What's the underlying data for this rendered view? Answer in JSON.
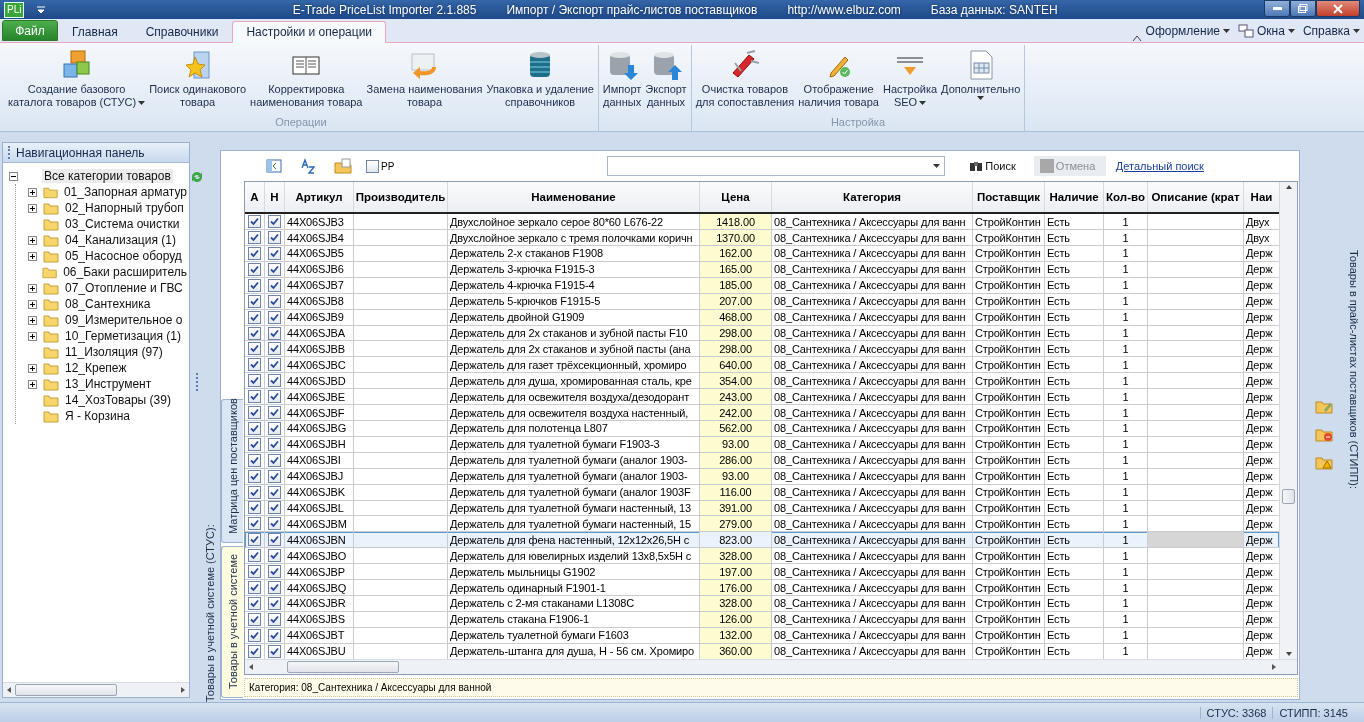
{
  "window": {
    "app_badge": "PLi",
    "title_parts": [
      "E-Trade PriceList Importer 2.1.885",
      "Импорт / Экспорт прайс-листов поставщиков",
      "http://www.elbuz.com",
      "База данных: SANTEH"
    ]
  },
  "ribbon": {
    "file_tab": "Файл",
    "tabs": [
      {
        "label": "Главная",
        "selected": false
      },
      {
        "label": "Справочники",
        "selected": false
      },
      {
        "label": "Настройки и операции",
        "selected": true
      }
    ],
    "right_menus": [
      "Оформление",
      "Окна",
      "Справка"
    ],
    "groups": [
      {
        "label": "Операции",
        "items": [
          {
            "lines": [
              "Создание базового",
              "каталога товаров (СТУС)"
            ],
            "dropdown": true
          },
          {
            "lines": [
              "Поиск одинакового",
              "товара"
            ],
            "dropdown": false
          },
          {
            "lines": [
              "Корректировка",
              "наименования товара"
            ],
            "dropdown": false
          },
          {
            "lines": [
              "Замена наименования",
              "товара"
            ],
            "dropdown": false
          },
          {
            "lines": [
              "Упаковка и удаление",
              "справочников"
            ],
            "dropdown": false
          }
        ]
      },
      {
        "items": [
          {
            "lines": [
              "Импорт",
              "данных"
            ],
            "dropdown": false
          },
          {
            "lines": [
              "Экспорт",
              "данных"
            ],
            "dropdown": false
          }
        ]
      },
      {
        "label": "Настройка",
        "items": [
          {
            "lines": [
              "Очистка товаров",
              "для сопоставления"
            ],
            "dropdown": false
          },
          {
            "lines": [
              "Отображение",
              "наличия товара"
            ],
            "dropdown": false
          },
          {
            "lines": [
              "Настройка",
              "SEO"
            ],
            "dropdown": true
          },
          {
            "lines": [
              "Дополнительно"
            ],
            "dropdown": true
          }
        ]
      }
    ]
  },
  "navigation": {
    "title": "Навигационная панель",
    "root": {
      "label": "Все категории товаров",
      "expanded": true,
      "selected": true,
      "children": [
        {
          "label": "01_Запорная арматур",
          "expandable": true,
          "selected": false
        },
        {
          "label": "02_Напорный трубоп",
          "expandable": true,
          "selected": false
        },
        {
          "label": "03_Система очистки",
          "expandable": false,
          "selected": false
        },
        {
          "label": "04_Канализация (1)",
          "expandable": true,
          "selected": false
        },
        {
          "label": "05_Насосное оборуд",
          "expandable": true,
          "selected": false
        },
        {
          "label": "06_Баки расширитель",
          "expandable": false,
          "selected": false
        },
        {
          "label": "07_Отопление и ГВС",
          "expandable": true,
          "selected": false
        },
        {
          "label": "08_Сантехника",
          "expandable": true,
          "selected": false
        },
        {
          "label": "09_Измерительное о",
          "expandable": true,
          "selected": false
        },
        {
          "label": "10_Герметизация (1)",
          "expandable": true,
          "selected": false
        },
        {
          "label": "11_Изоляция (97)",
          "expandable": false,
          "selected": false
        },
        {
          "label": "12_Крепеж",
          "expandable": true,
          "selected": false
        },
        {
          "label": "13_Инструмент",
          "expandable": true,
          "selected": false
        },
        {
          "label": "14_ХозТовары (39)",
          "expandable": false,
          "selected": false
        },
        {
          "label": "Я - Корзина",
          "expandable": false,
          "selected": false
        }
      ]
    }
  },
  "stus_caption": "Товары в учетной системе (СТУС):",
  "view_tabs": [
    {
      "label": "Матрица цен поставщиков",
      "selected": false
    },
    {
      "label": "Товары в учетной системе",
      "selected": true
    }
  ],
  "toolbar": {
    "pp": {
      "label": "PP",
      "checked": false
    },
    "search_button": "Поиск",
    "cancel": {
      "label": "Отмена",
      "disabled": true
    },
    "detail_link": "Детальный поиск"
  },
  "table": {
    "columns": [
      {
        "label": "А",
        "kind": "check"
      },
      {
        "label": "Н",
        "kind": "check"
      },
      {
        "label": "Артикул",
        "kind": "text"
      },
      {
        "label": "Производитель",
        "kind": "text"
      },
      {
        "label": "Наименование",
        "kind": "text"
      },
      {
        "label": "Цена",
        "kind": "price"
      },
      {
        "label": "Категория",
        "kind": "text"
      },
      {
        "label": "Поставщик",
        "kind": "text"
      },
      {
        "label": "Наличие",
        "kind": "text"
      },
      {
        "label": "Кол-во",
        "kind": "number"
      },
      {
        "label": "Описание (крат",
        "kind": "text"
      },
      {
        "label": "Наи",
        "kind": "text"
      }
    ],
    "rows": [
      {
        "a": true,
        "h": true,
        "article": "44X06SJB3",
        "name": "Двухслойное зеркало серое 80*60 L676-22",
        "price": "1418.00",
        "category": "08_Сантехника / Аксессуары для ванн",
        "supplier": "СтройКонтин",
        "availability": "Есть",
        "qty": "1",
        "column_12": "Двух",
        "selected": false
      },
      {
        "a": true,
        "h": true,
        "article": "44X06SJB4",
        "name": "Двухслойное зеркало с тремя полочками коричн",
        "price": "1370.00",
        "category": "08_Сантехника / Аксессуары для ванн",
        "supplier": "СтройКонтин",
        "availability": "Есть",
        "qty": "1",
        "column_12": "Двух",
        "selected": false
      },
      {
        "a": true,
        "h": true,
        "article": "44X06SJB5",
        "name": "Держатель 2-х стаканов F1908",
        "price": "162.00",
        "category": "08_Сантехника / Аксессуары для ванн",
        "supplier": "СтройКонтин",
        "availability": "Есть",
        "qty": "1",
        "column_12": "Держ",
        "selected": false
      },
      {
        "a": true,
        "h": true,
        "article": "44X06SJB6",
        "name": "Держатель 3-крючка F1915-3",
        "price": "165.00",
        "category": "08_Сантехника / Аксессуары для ванн",
        "supplier": "СтройКонтин",
        "availability": "Есть",
        "qty": "1",
        "column_12": "Держ",
        "selected": false
      },
      {
        "a": true,
        "h": true,
        "article": "44X06SJB7",
        "name": "Держатель 4-крючка F1915-4",
        "price": "185.00",
        "category": "08_Сантехника / Аксессуары для ванн",
        "supplier": "СтройКонтин",
        "availability": "Есть",
        "qty": "1",
        "column_12": "Держ",
        "selected": false
      },
      {
        "a": true,
        "h": true,
        "article": "44X06SJB8",
        "name": "Держатель 5-крючков F1915-5",
        "price": "207.00",
        "category": "08_Сантехника / Аксессуары для ванн",
        "supplier": "СтройКонтин",
        "availability": "Есть",
        "qty": "1",
        "column_12": "Держ",
        "selected": false
      },
      {
        "a": true,
        "h": true,
        "article": "44X06SJB9",
        "name": "Держатель двойной G1909",
        "price": "468.00",
        "category": "08_Сантехника / Аксессуары для ванн",
        "supplier": "СтройКонтин",
        "availability": "Есть",
        "qty": "1",
        "column_12": "Держ",
        "selected": false
      },
      {
        "a": true,
        "h": true,
        "article": "44X06SJBA",
        "name": "Держатель для 2х стаканов и зубной пасты F10",
        "price": "298.00",
        "category": "08_Сантехника / Аксессуары для ванн",
        "supplier": "СтройКонтин",
        "availability": "Есть",
        "qty": "1",
        "column_12": "Держ",
        "selected": false
      },
      {
        "a": true,
        "h": true,
        "article": "44X06SJBB",
        "name": "Держатель для 2х стаканов и зубной пасты (ана",
        "price": "298.00",
        "category": "08_Сантехника / Аксессуары для ванн",
        "supplier": "СтройКонтин",
        "availability": "Есть",
        "qty": "1",
        "column_12": "Держ",
        "selected": false
      },
      {
        "a": true,
        "h": true,
        "article": "44X06SJBC",
        "name": "Держатель для газет трёхсекционный, хромиро",
        "price": "640.00",
        "category": "08_Сантехника / Аксессуары для ванн",
        "supplier": "СтройКонтин",
        "availability": "Есть",
        "qty": "1",
        "column_12": "Держ",
        "selected": false
      },
      {
        "a": true,
        "h": true,
        "article": "44X06SJBD",
        "name": "Держатель для душа, хромированная сталь, кре",
        "price": "354.00",
        "category": "08_Сантехника / Аксессуары для ванн",
        "supplier": "СтройКонтин",
        "availability": "Есть",
        "qty": "1",
        "column_12": "Держ",
        "selected": false
      },
      {
        "a": true,
        "h": true,
        "article": "44X06SJBE",
        "name": "Держатель для освежителя воздуха/дезодорант",
        "price": "243.00",
        "category": "08_Сантехника / Аксессуары для ванн",
        "supplier": "СтройКонтин",
        "availability": "Есть",
        "qty": "1",
        "column_12": "Держ",
        "selected": false
      },
      {
        "a": true,
        "h": true,
        "article": "44X06SJBF",
        "name": "Держатель для освежителя воздуха настенный,",
        "price": "242.00",
        "category": "08_Сантехника / Аксессуары для ванн",
        "supplier": "СтройКонтин",
        "availability": "Есть",
        "qty": "1",
        "column_12": "Держ",
        "selected": false
      },
      {
        "a": true,
        "h": true,
        "article": "44X06SJBG",
        "name": "Держатель для полотенца L807",
        "price": "562.00",
        "category": "08_Сантехника / Аксессуары для ванн",
        "supplier": "СтройКонтин",
        "availability": "Есть",
        "qty": "1",
        "column_12": "Держ",
        "selected": false
      },
      {
        "a": true,
        "h": true,
        "article": "44X06SJBH",
        "name": "Держатель для туалетной бумаги F1903-3",
        "price": "93.00",
        "category": "08_Сантехника / Аксессуары для ванн",
        "supplier": "СтройКонтин",
        "availability": "Есть",
        "qty": "1",
        "column_12": "Держ",
        "selected": false
      },
      {
        "a": true,
        "h": true,
        "article": "44X06SJBI",
        "name": "Держатель для туалетной бумаги (аналог 1903-",
        "price": "286.00",
        "category": "08_Сантехника / Аксессуары для ванн",
        "supplier": "СтройКонтин",
        "availability": "Есть",
        "qty": "1",
        "column_12": "Держ",
        "selected": false
      },
      {
        "a": true,
        "h": true,
        "article": "44X06SJBJ",
        "name": "Держатель для туалетной бумаги (аналог 1903-",
        "price": "93.00",
        "category": "08_Сантехника / Аксессуары для ванн",
        "supplier": "СтройКонтин",
        "availability": "Есть",
        "qty": "1",
        "column_12": "Держ",
        "selected": false
      },
      {
        "a": true,
        "h": true,
        "article": "44X06SJBK",
        "name": "Держатель для туалетной бумаги (аналог 1903F",
        "price": "116.00",
        "category": "08_Сантехника / Аксессуары для ванн",
        "supplier": "СтройКонтин",
        "availability": "Есть",
        "qty": "1",
        "column_12": "Держ",
        "selected": false
      },
      {
        "a": true,
        "h": true,
        "article": "44X06SJBL",
        "name": "Держатель для туалетной бумаги настенный, 13",
        "price": "391.00",
        "category": "08_Сантехника / Аксессуары для ванн",
        "supplier": "СтройКонтин",
        "availability": "Есть",
        "qty": "1",
        "column_12": "Держ",
        "selected": false
      },
      {
        "a": true,
        "h": true,
        "article": "44X06SJBM",
        "name": "Держатель для туалетной бумаги настенный, 15",
        "price": "279.00",
        "category": "08_Сантехника / Аксессуары для ванн",
        "supplier": "СтройКонтин",
        "availability": "Есть",
        "qty": "1",
        "column_12": "Держ",
        "selected": false
      },
      {
        "a": true,
        "h": true,
        "article": "44X06SJBN",
        "name": "Держатель для фена настенный, 12х12х26,5Н с",
        "price": "823.00",
        "category": "08_Сантехника / Аксессуары для ванн",
        "supplier": "СтройКонтин",
        "availability": "Есть",
        "qty": "1",
        "column_12": "Держ",
        "selected": true
      },
      {
        "a": true,
        "h": true,
        "article": "44X06SJBO",
        "name": "Держатель для ювелирных изделий 13х8,5х5Н с",
        "price": "328.00",
        "category": "08_Сантехника / Аксессуары для ванн",
        "supplier": "СтройКонтин",
        "availability": "Есть",
        "qty": "1",
        "column_12": "Держ",
        "selected": false
      },
      {
        "a": true,
        "h": true,
        "article": "44X06SJBP",
        "name": "Держатель мыльницы G1902",
        "price": "197.00",
        "category": "08_Сантехника / Аксессуары для ванн",
        "supplier": "СтройКонтин",
        "availability": "Есть",
        "qty": "1",
        "column_12": "Держ",
        "selected": false
      },
      {
        "a": true,
        "h": true,
        "article": "44X06SJBQ",
        "name": "Держатель одинарный F1901-1",
        "price": "176.00",
        "category": "08_Сантехника / Аксессуары для ванн",
        "supplier": "СтройКонтин",
        "availability": "Есть",
        "qty": "1",
        "column_12": "Держ",
        "selected": false
      },
      {
        "a": true,
        "h": true,
        "article": "44X06SJBR",
        "name": "Держатель с 2-мя стаканами L1308C",
        "price": "328.00",
        "category": "08_Сантехника / Аксессуары для ванн",
        "supplier": "СтройКонтин",
        "availability": "Есть",
        "qty": "1",
        "column_12": "Держ",
        "selected": false
      },
      {
        "a": true,
        "h": true,
        "article": "44X06SJBS",
        "name": "Держатель стакана F1906-1",
        "price": "126.00",
        "category": "08_Сантехника / Аксессуары для ванн",
        "supplier": "СтройКонтин",
        "availability": "Есть",
        "qty": "1",
        "column_12": "Держ",
        "selected": false
      },
      {
        "a": true,
        "h": true,
        "article": "44X06SJBT",
        "name": "Держатель туалетной бумаги F1603",
        "price": "132.00",
        "category": "08_Сантехника / Аксессуары для ванн",
        "supplier": "СтройКонтин",
        "availability": "Есть",
        "qty": "1",
        "column_12": "Держ",
        "selected": false
      },
      {
        "a": true,
        "h": true,
        "article": "44X06SJBU",
        "name": "Держатель-штанга для душа, Н - 56 см. Хромиро",
        "price": "360.00",
        "category": "08_Сантехника / Аксессуары для ванн",
        "supplier": "СтройКонтин",
        "availability": "Есть",
        "qty": "1",
        "column_12": "Держ",
        "selected": false
      }
    ]
  },
  "category_bar": "Категория: 08_Сантехника / Аксессуары для ванной",
  "stipp_caption": "Товары в прайс-листах поставщиков (СТИПП):",
  "status_bar": [
    "СТУС: 3368",
    "СТИПП: 3145"
  ]
}
